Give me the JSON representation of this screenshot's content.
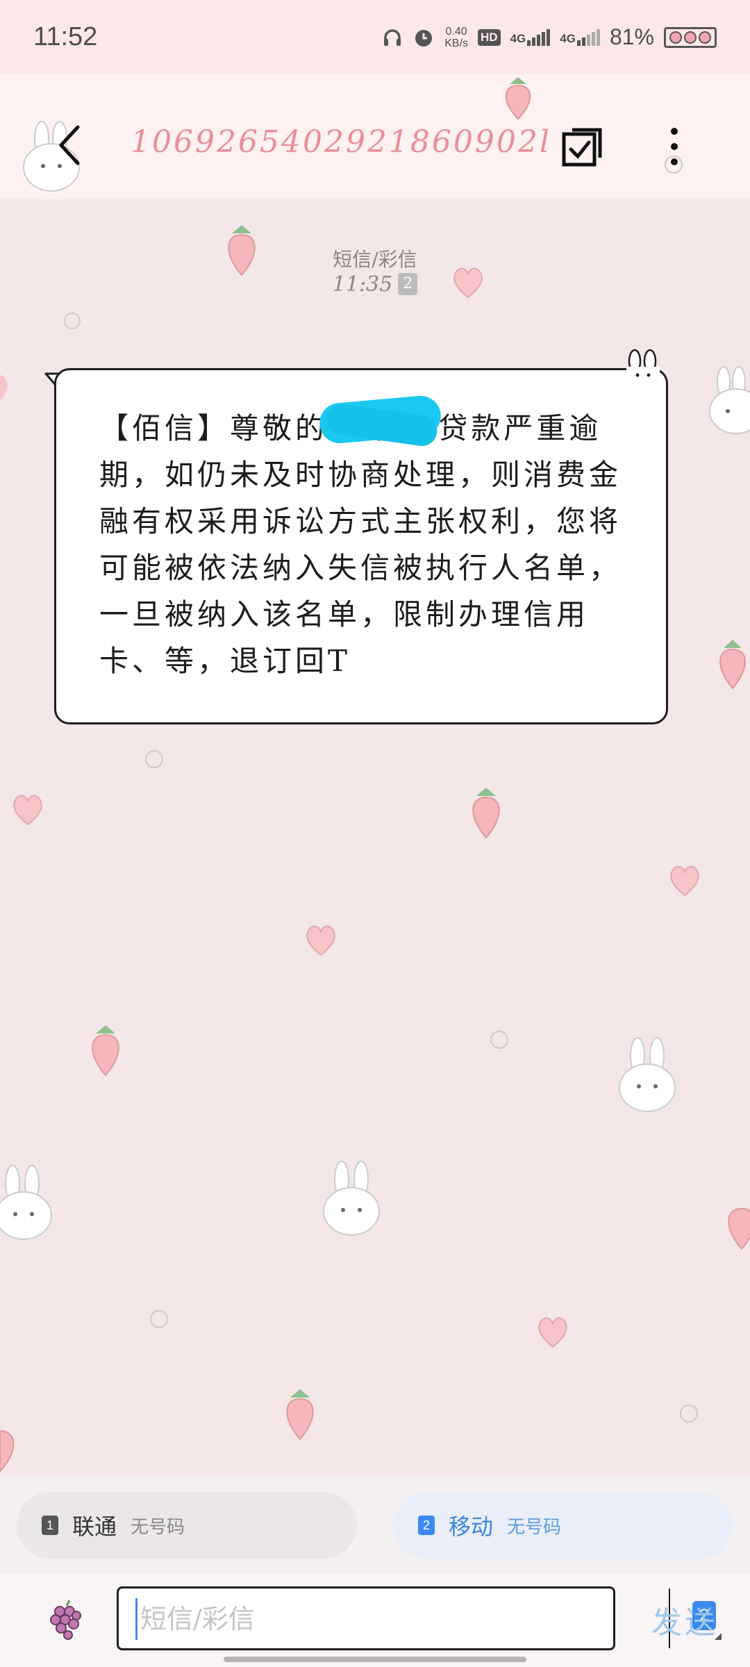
{
  "status_bar": {
    "time": "11:52",
    "net_speed_value": "0.40",
    "net_speed_unit": "KB/s",
    "hd_label": "HD",
    "sim_tag_1": "4G",
    "sim_tag_2": "4G",
    "battery_percent": "81%"
  },
  "header": {
    "title": "1069265402921860902l",
    "icons": [
      "back-arrow-icon",
      "multi-select-icon",
      "more-vertical-icon"
    ]
  },
  "conversation": {
    "message_type": "短信/彩信",
    "timestamp": "11:35",
    "sim_slot": "2",
    "message_text": "【佰信】尊敬的三    你的贷款严重逾期，如仍未及时协商处理，则消费金融有权采用诉讼方式主张权利，您将可能被依法纳入失信被执行人名单，一旦被纳入该名单，限制办理信用卡、等，退订回T"
  },
  "sim_selector": {
    "sim1": {
      "slot": "1",
      "carrier": "联通",
      "number": "无号码"
    },
    "sim2": {
      "slot": "2",
      "carrier": "移动",
      "number": "无号码"
    }
  },
  "composer": {
    "placeholder": "短信/彩信",
    "value": "",
    "sim_slot": "2",
    "send_label": "发送"
  },
  "colors": {
    "accent": "#3b8af0",
    "title_pink": "#e88f99",
    "redaction": "#1dc8f0"
  }
}
